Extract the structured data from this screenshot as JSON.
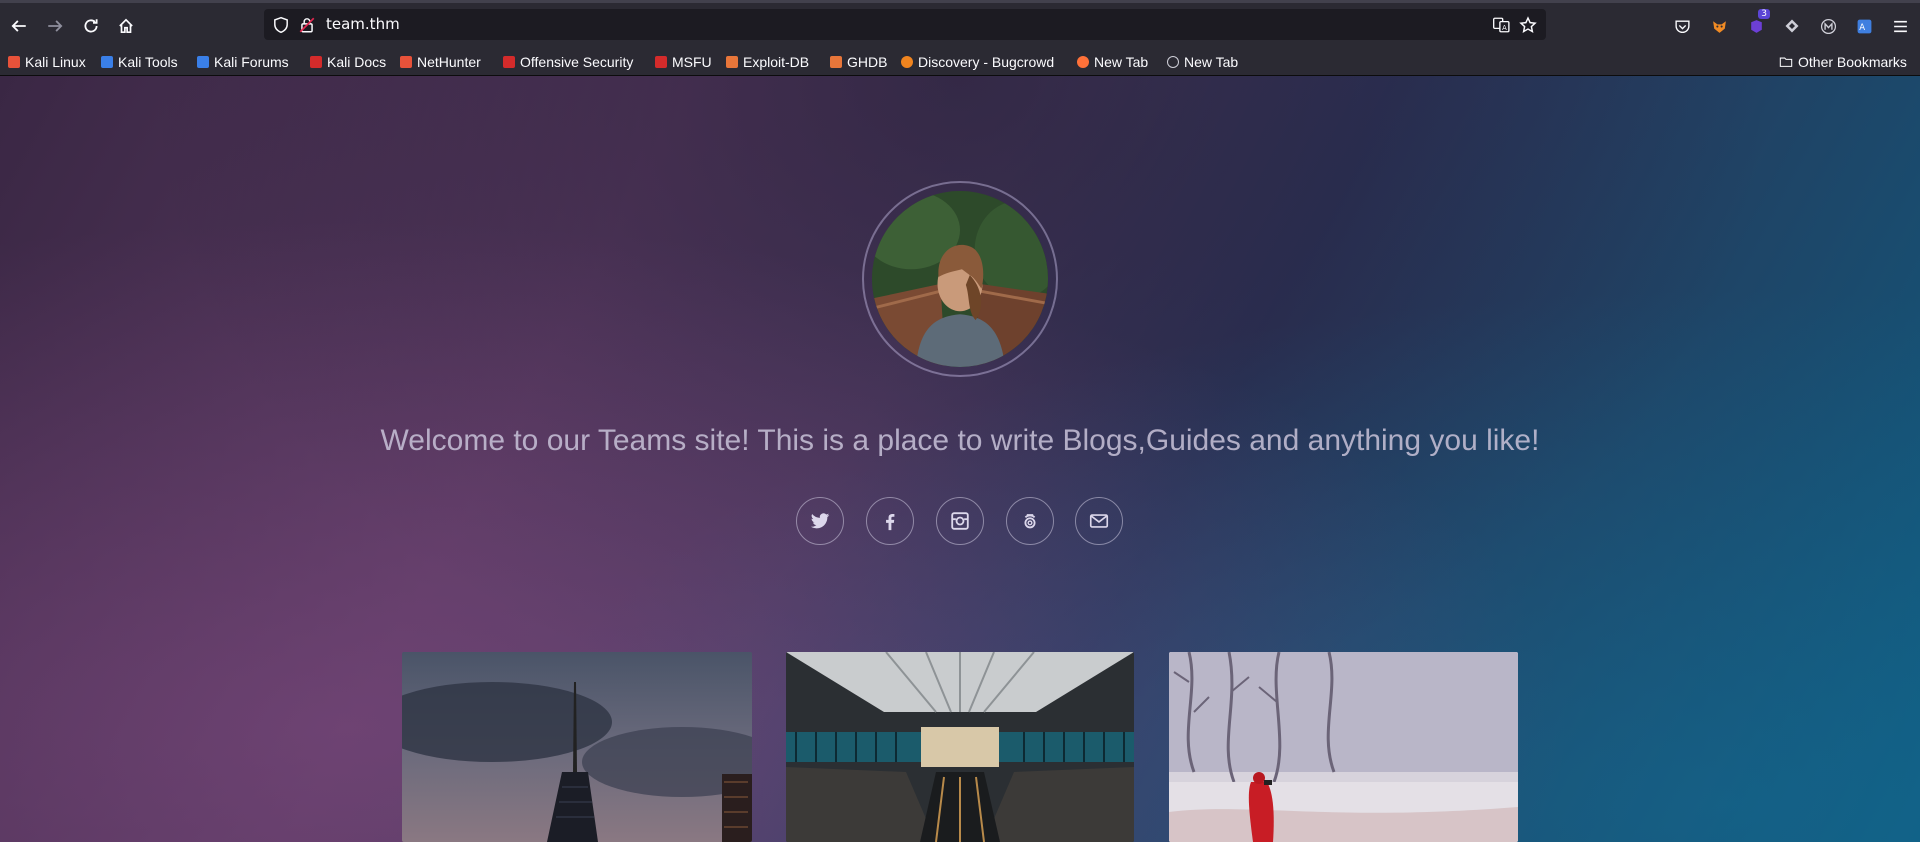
{
  "browser": {
    "url": "team.thm",
    "bookmarks": [
      {
        "label": "Kali Linux",
        "color": "#e8523a"
      },
      {
        "label": "Kali Tools",
        "color": "#3a7fe8"
      },
      {
        "label": "Kali Forums",
        "color": "#3a7fe8"
      },
      {
        "label": "Kali Docs",
        "color": "#d42b2b"
      },
      {
        "label": "NetHunter",
        "color": "#e8523a"
      },
      {
        "label": "Offensive Security",
        "color": "#d42b2b"
      },
      {
        "label": "MSFU",
        "color": "#d42b2b"
      },
      {
        "label": "Exploit-DB",
        "color": "#e8763a"
      },
      {
        "label": "GHDB",
        "color": "#e8763a"
      },
      {
        "label": "Discovery - Bugcrowd",
        "color": "#f0841f"
      },
      {
        "label": "New Tab",
        "color": "#ff7139"
      },
      {
        "label": "New Tab",
        "color": "#cfcfd8"
      }
    ],
    "other_bookmarks": "Other Bookmarks",
    "extension_badge": "3"
  },
  "hero": {
    "welcome_text": "Welcome to our Teams site! This is a place to write Blogs,Guides and anything you like!",
    "social_icons": [
      "twitter-icon",
      "facebook-icon",
      "instagram-icon",
      "500px-icon",
      "email-icon"
    ]
  },
  "gallery": {
    "cards": [
      "city-tower-photo",
      "escalator-station-photo",
      "snow-hiker-photo"
    ]
  }
}
